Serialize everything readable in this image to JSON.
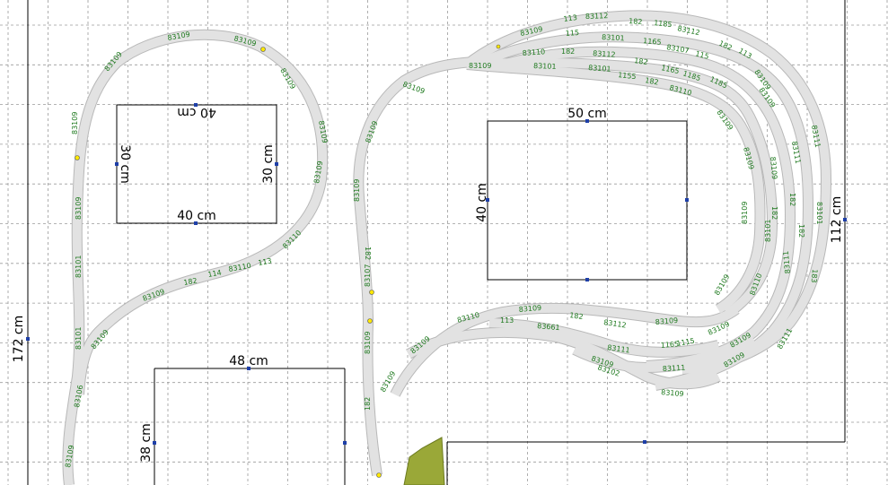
{
  "dimensions": {
    "small_box_top": "40 cm",
    "small_box_bottom": "40 cm",
    "small_box_left": "30 cm",
    "small_box_right": "30 cm",
    "large_box_top": "50 cm",
    "large_box_left": "40 cm",
    "bottom_box_top": "48 cm",
    "bottom_box_left": "38 cm",
    "layout_height": "172 cm",
    "right_section_height": "112 cm"
  },
  "track_labels": {
    "left_loop": [
      "83109",
      "83109",
      "83109",
      "83109",
      "83109",
      "83109",
      "83109",
      "83110",
      "83109",
      "83109",
      "114",
      "83110",
      "113",
      "182",
      "83109",
      "83101",
      "83101",
      "83109",
      "83101",
      "83122",
      "83106",
      "83109"
    ],
    "center": [
      "83109",
      "83109",
      "83109",
      "83109",
      "182",
      "83107",
      "183",
      "182",
      "182",
      "183"
    ],
    "top_fan": [
      "113",
      "83112",
      "182",
      "1185",
      "83112",
      "83109",
      "115",
      "83101",
      "1165",
      "83107",
      "115",
      "182",
      "83109",
      "83110",
      "182",
      "83112",
      "1155",
      "83101",
      "1182",
      "182",
      "182",
      "83110",
      "1165",
      "83112",
      "1185",
      "1185",
      "83109",
      "113"
    ],
    "right_curves": [
      "83109",
      "83109",
      "83109",
      "83111",
      "83109",
      "83111",
      "83109",
      "83101",
      "182",
      "182",
      "182",
      "183",
      "83109",
      "83101",
      "83111",
      "83111",
      "83111",
      "83110"
    ],
    "bottom_arcs": [
      "83109",
      "182",
      "83112",
      "83109",
      "113",
      "83661",
      "83110",
      "83109",
      "83111",
      "1165",
      "1115",
      "83109",
      "83109",
      "83109",
      "83109",
      "83111",
      "83109",
      "83111",
      "83109",
      "83102",
      "83109"
    ]
  }
}
